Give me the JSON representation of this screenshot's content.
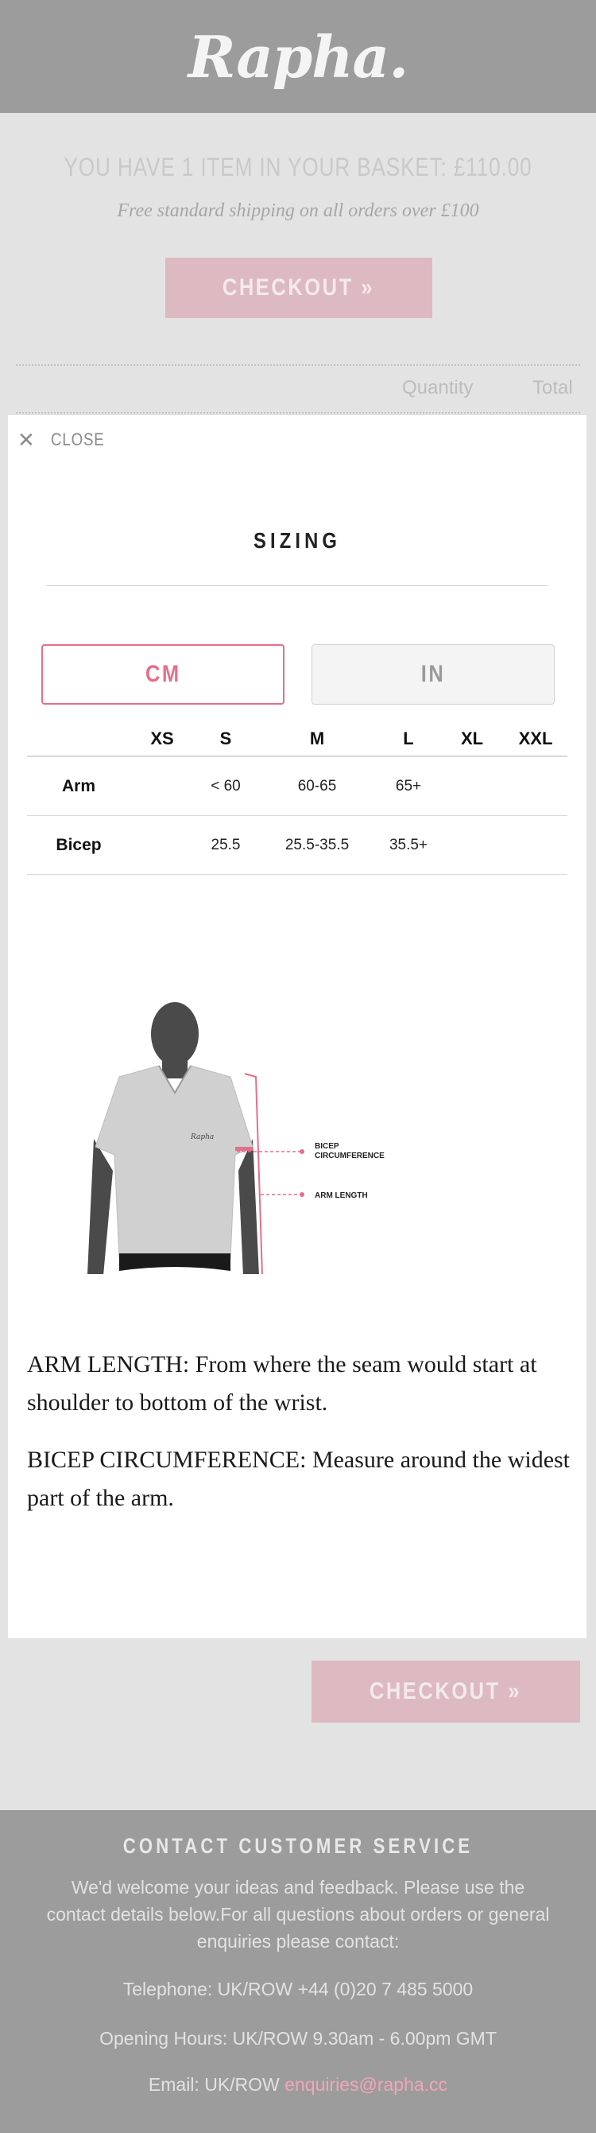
{
  "header": {
    "logo_text": "Rapha."
  },
  "basket": {
    "title": "YOU HAVE 1 ITEM IN YOUR BASKET: £110.00",
    "shipping_note": "Free standard shipping on all orders over £100",
    "checkout_label": "CHECKOUT »",
    "columns": {
      "quantity": "Quantity",
      "total": "Total"
    }
  },
  "modal": {
    "close_label": "CLOSE",
    "title": "SIZING",
    "units": {
      "cm": "CM",
      "in": "IN",
      "selected": "CM"
    },
    "table": {
      "headers": [
        "",
        "XS",
        "S",
        "M",
        "L",
        "XL",
        "XXL"
      ],
      "rows": [
        {
          "label": "Arm",
          "values": [
            "",
            "< 60",
            "60-65",
            "65+",
            "",
            ""
          ]
        },
        {
          "label": "Bicep",
          "values": [
            "",
            "25.5",
            "25.5-35.5",
            "35.5+",
            "",
            ""
          ]
        }
      ]
    },
    "illustration": {
      "logo_mark": "Rapha",
      "label_bicep_1": "BICEP",
      "label_bicep_2": "CIRCUMFERENCE",
      "label_arm": "ARM LENGTH"
    },
    "notes": {
      "arm": "ARM LENGTH: From where the seam would start at shoulder to bottom of the wrist.",
      "bicep": "BICEP CIRCUMFERENCE: Measure around the widest part of the arm."
    }
  },
  "bottom": {
    "checkout_label": "CHECKOUT »"
  },
  "footer": {
    "title": "CONTACT CUSTOMER SERVICE",
    "body": "We'd welcome your ideas and feedback. Please use the contact details below.For all questions about orders or general enquiries please contact:",
    "telephone": "Telephone: UK/ROW +44 (0)20 7 485 5000",
    "hours": "Opening Hours: UK/ROW 9.30am - 6.00pm GMT",
    "email_prefix": "Email: UK/ROW ",
    "email": "enquiries@rapha.cc"
  },
  "colors": {
    "accent": "#e66e88",
    "checkout_bg": "#ddb9c2",
    "header_bg": "#9c9c9c",
    "page_bg": "#e3e3e3"
  }
}
